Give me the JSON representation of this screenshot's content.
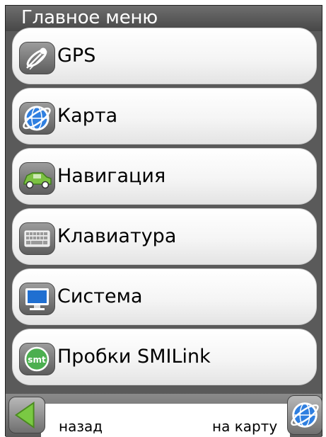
{
  "header": {
    "title": "Главное меню"
  },
  "menu": {
    "items": [
      {
        "label": "GPS",
        "icon": "satellite-icon"
      },
      {
        "label": "Карта",
        "icon": "globe-icon"
      },
      {
        "label": "Навигация",
        "icon": "car-icon"
      },
      {
        "label": "Клавиатура",
        "icon": "keyboard-icon"
      },
      {
        "label": "Система",
        "icon": "monitor-icon"
      },
      {
        "label": "Пробки SMILink",
        "icon": "smilink-icon",
        "icon_text": "smt"
      }
    ]
  },
  "footer": {
    "back_label": "назад",
    "map_label": "на карту",
    "back_icon": "back-arrow-icon",
    "map_icon": "globe-icon"
  },
  "colors": {
    "bar": "#5a5a5a",
    "globe": "#2f7fe0",
    "car": "#7cc142",
    "arrow": "#7ac943",
    "smilink": "#4caf50"
  }
}
